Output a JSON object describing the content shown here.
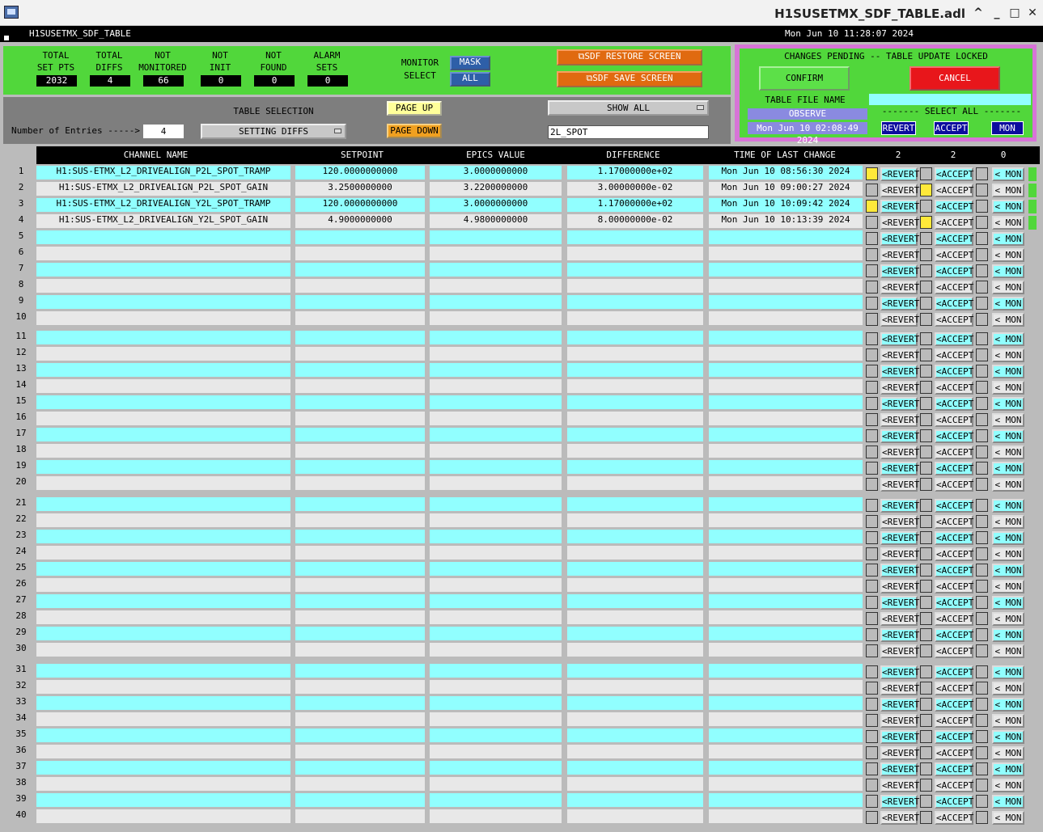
{
  "window": {
    "title": "H1SUSETMX_SDF_TABLE.adl",
    "min_glyph": "^",
    "restore_glyph": "_",
    "max_glyph": "□",
    "close_glyph": "✕"
  },
  "header": {
    "left": "H1SUSETMX_SDF_TABLE",
    "right": "Mon Jun 10 11:28:07 2024"
  },
  "stats": [
    {
      "label1": "TOTAL",
      "label2": "SET PTS",
      "value": "2032"
    },
    {
      "label1": "TOTAL",
      "label2": "DIFFS",
      "value": "4"
    },
    {
      "label1": "NOT",
      "label2": "MONITORED",
      "value": "66"
    },
    {
      "label1": "NOT",
      "label2": "INIT",
      "value": "0"
    },
    {
      "label1": "NOT",
      "label2": "FOUND",
      "value": "0"
    },
    {
      "label1": "ALARM",
      "label2": "SETS",
      "value": "0"
    }
  ],
  "monitor": {
    "label1": "MONITOR",
    "label2": "SELECT",
    "mask": "MASK",
    "all": "ALL"
  },
  "screens": {
    "restore": "⧉SDF RESTORE SCREEN",
    "save": "⧉SDF SAVE SCREEN"
  },
  "controls": {
    "table_selection_label": "TABLE SELECTION",
    "table_selection_value": "SETTING DIFFS",
    "entries_label": "Number of Entries ----->",
    "entries_value": "4",
    "page_up": "PAGE UP",
    "page_down": "PAGE DOWN",
    "show_all": "SHOW ALL",
    "filter_value": "2L_SPOT"
  },
  "pending": {
    "title": "CHANGES PENDING -- TABLE UPDATE LOCKED",
    "confirm": "CONFIRM",
    "cancel": "CANCEL",
    "file_label": "TABLE FILE NAME",
    "file_value": "",
    "observe": "OBSERVE",
    "select_all": "------- SELECT ALL -------",
    "timestamp": "Mon Jun 10 02:08:49 2024",
    "revert": "REVERT",
    "accept": "ACCEPT",
    "mon": "MON"
  },
  "table": {
    "headers": {
      "channel": "CHANNEL NAME",
      "setpoint": "SETPOINT",
      "epics": "EPICS VALUE",
      "difference": "DIFFERENCE",
      "time": "TIME OF LAST CHANGE",
      "c1": "2",
      "c2": "2",
      "c3": "0"
    },
    "revert_label": "<REVERT",
    "accept_label": "<ACCEPT",
    "mon_label": "< MON",
    "rows": [
      {
        "n": "1",
        "channel": "H1:SUS-ETMX_L2_DRIVEALIGN_P2L_SPOT_TRAMP",
        "setpoint": "120.0000000000",
        "epics": "3.0000000000",
        "difference": "1.17000000e+02",
        "time": "Mon Jun 10 08:56:30 2024"
      },
      {
        "n": "2",
        "channel": "H1:SUS-ETMX_L2_DRIVEALIGN_P2L_SPOT_GAIN",
        "setpoint": "3.2500000000",
        "epics": "3.2200000000",
        "difference": "3.00000000e-02",
        "time": "Mon Jun 10 09:00:27 2024"
      },
      {
        "n": "3",
        "channel": "H1:SUS-ETMX_L2_DRIVEALIGN_Y2L_SPOT_TRAMP",
        "setpoint": "120.0000000000",
        "epics": "3.0000000000",
        "difference": "1.17000000e+02",
        "time": "Mon Jun 10 10:09:42 2024"
      },
      {
        "n": "4",
        "channel": "H1:SUS-ETMX_L2_DRIVEALIGN_Y2L_SPOT_GAIN",
        "setpoint": "4.9000000000",
        "epics": "4.9800000000",
        "difference": "8.00000000e-02",
        "time": "Mon Jun 10 10:13:39 2024"
      },
      {
        "n": "5"
      },
      {
        "n": "6"
      },
      {
        "n": "7"
      },
      {
        "n": "8"
      },
      {
        "n": "9"
      },
      {
        "n": "10"
      },
      {
        "n": "11"
      },
      {
        "n": "12"
      },
      {
        "n": "13"
      },
      {
        "n": "14"
      },
      {
        "n": "15"
      },
      {
        "n": "16"
      },
      {
        "n": "17"
      },
      {
        "n": "18"
      },
      {
        "n": "19"
      },
      {
        "n": "20"
      },
      {
        "n": "21"
      },
      {
        "n": "22"
      },
      {
        "n": "23"
      },
      {
        "n": "24"
      },
      {
        "n": "25"
      },
      {
        "n": "26"
      },
      {
        "n": "27"
      },
      {
        "n": "28"
      },
      {
        "n": "29"
      },
      {
        "n": "30"
      },
      {
        "n": "31"
      },
      {
        "n": "32"
      },
      {
        "n": "33"
      },
      {
        "n": "34"
      },
      {
        "n": "35"
      },
      {
        "n": "36"
      },
      {
        "n": "37"
      },
      {
        "n": "38"
      },
      {
        "n": "39"
      },
      {
        "n": "40"
      }
    ],
    "revert_checked_rows": [
      1,
      3
    ],
    "accept_checked_rows": [
      2,
      4
    ],
    "status_marks_rows": [
      1,
      2,
      3,
      4
    ]
  },
  "colors": {
    "green": "#51d73b",
    "cyan": "#91ffff",
    "light": "#e8e8e8",
    "yellow": "#ffe93a",
    "red": "#e8161b",
    "orange": "#e06a10",
    "blue": "#2e5fa8",
    "magenta": "#d774d7"
  }
}
